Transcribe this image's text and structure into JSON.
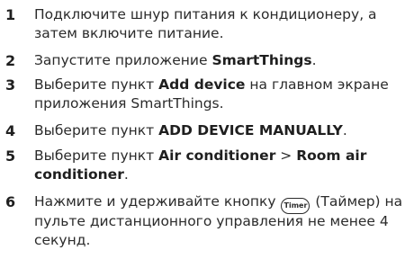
{
  "steps": [
    {
      "num": "1",
      "text": "Подключите шнур питания к кондиционеру, а затем включите питание."
    },
    {
      "num": "2",
      "text_before": "Запустите приложение ",
      "bold": "SmartThings",
      "text_after": "."
    },
    {
      "num": "3",
      "text_before": "Выберите пункт ",
      "bold": "Add device",
      "text_after": " на главном экране приложения SmartThings."
    },
    {
      "num": "4",
      "text_before": "Выберите пункт ",
      "bold": "ADD DEVICE MANUALLY",
      "text_after": "."
    },
    {
      "num": "5",
      "text_before": "Выберите пункт ",
      "bold1": "Air conditioner",
      "separator": " > ",
      "bold2": "Room air conditioner",
      "text_after": "."
    },
    {
      "num": "6",
      "text_before": "Нажмите и удерживайте кнопку ",
      "icon_label": "Timer",
      "text_after": " (Таймер) на пульте дистанционного управления не менее 4 секунд."
    }
  ]
}
